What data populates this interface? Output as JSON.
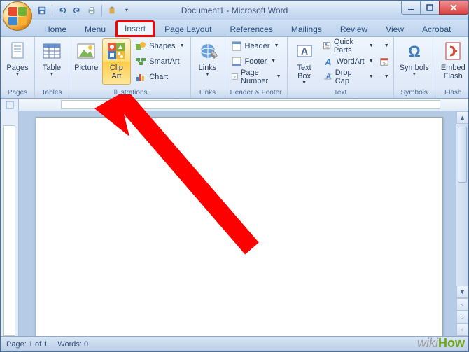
{
  "title": "Document1 - Microsoft Word",
  "tabs": [
    "Home",
    "Menu",
    "Insert",
    "Page Layout",
    "References",
    "Mailings",
    "Review",
    "View",
    "Acrobat"
  ],
  "active_tab": "Insert",
  "ribbon": {
    "pages": {
      "label": "Pages",
      "btn": "Pages"
    },
    "tables": {
      "label": "Tables",
      "btn": "Table"
    },
    "illustrations": {
      "label": "Illustrations",
      "picture": "Picture",
      "clipart": "Clip Art",
      "shapes": "Shapes",
      "smartart": "SmartArt",
      "chart": "Chart"
    },
    "links": {
      "label": "Links",
      "btn": "Links"
    },
    "headerfooter": {
      "label": "Header & Footer",
      "header": "Header",
      "footer": "Footer",
      "pagenum": "Page Number"
    },
    "text": {
      "label": "Text",
      "textbox": "Text Box",
      "quickparts": "Quick Parts",
      "wordart": "WordArt",
      "dropcap": "Drop Cap"
    },
    "symbols": {
      "label": "Symbols",
      "btn": "Symbols"
    },
    "flash": {
      "label": "Flash",
      "btn": "Embed Flash"
    }
  },
  "status": {
    "page": "Page: 1 of 1",
    "words": "Words: 0"
  },
  "watermark": {
    "site": "wiki",
    "how": "How"
  }
}
